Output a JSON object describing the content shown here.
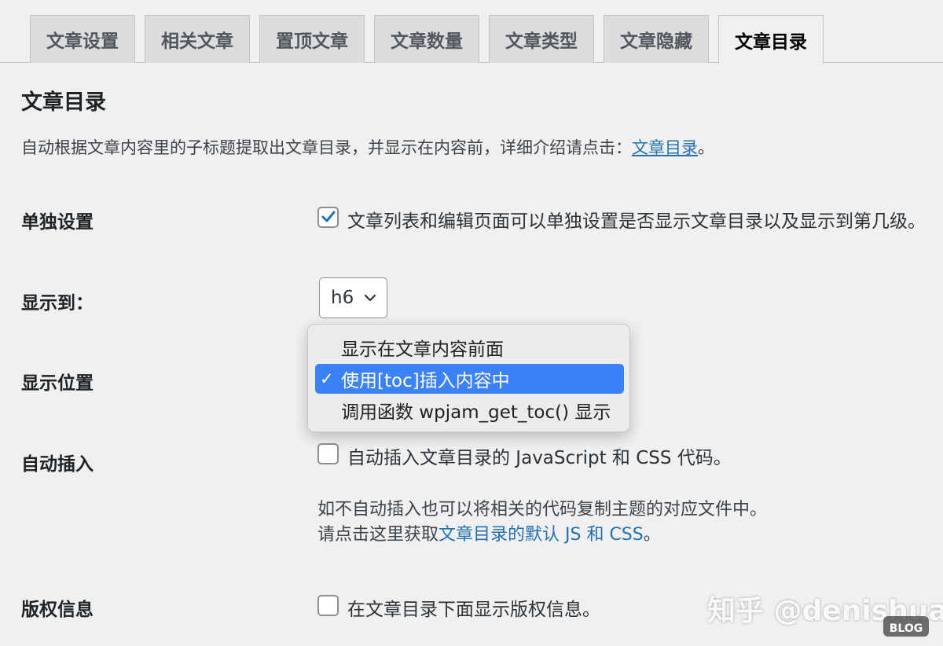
{
  "tabs": [
    {
      "label": "文章设置",
      "active": false
    },
    {
      "label": "相关文章",
      "active": false
    },
    {
      "label": "置顶文章",
      "active": false
    },
    {
      "label": "文章数量",
      "active": false
    },
    {
      "label": "文章类型",
      "active": false
    },
    {
      "label": "文章隐藏",
      "active": false
    },
    {
      "label": "文章目录",
      "active": true
    }
  ],
  "page": {
    "title": "文章目录",
    "intro_text": "自动根据文章内容里的子标题提取出文章目录，并显示在内容前，详细介绍请点击：",
    "intro_link": "文章目录",
    "intro_end": "。"
  },
  "settings": {
    "individual": {
      "label": "单独设置",
      "checkbox_label": "文章列表和编辑页面可以单独设置是否显示文章目录以及显示到第几级。",
      "checked": true
    },
    "depth": {
      "label": "显示到：",
      "selected": "h6"
    },
    "position": {
      "label": "显示位置",
      "options": [
        {
          "label": "显示在文章内容前面",
          "selected": false
        },
        {
          "label": "使用[toc]插入内容中",
          "selected": true
        },
        {
          "label": "调用函数 wpjam_get_toc() 显示",
          "selected": false
        }
      ],
      "check_mark": "✓"
    },
    "auto_insert": {
      "label": "自动插入",
      "checkbox_label": "自动插入文章目录的 JavaScript 和 CSS 代码。",
      "checked": false,
      "desc_line1": "如不自动插入也可以将相关的代码复制主题的对应文件中。",
      "desc_line2_prefix": "请点击这里获取",
      "desc_line2_link": "文章目录的默认 JS 和 CSS",
      "desc_line2_suffix": "。"
    },
    "copyright": {
      "label": "版权信息",
      "checkbox_label": "在文章目录下面显示版权信息。",
      "checked": false
    }
  },
  "watermark": {
    "text": "知乎 @denishua",
    "badge": "BLOG"
  },
  "colors": {
    "accent": "#2271b1",
    "selected_option": "#3b82f6",
    "background": "#f0f0f1"
  }
}
